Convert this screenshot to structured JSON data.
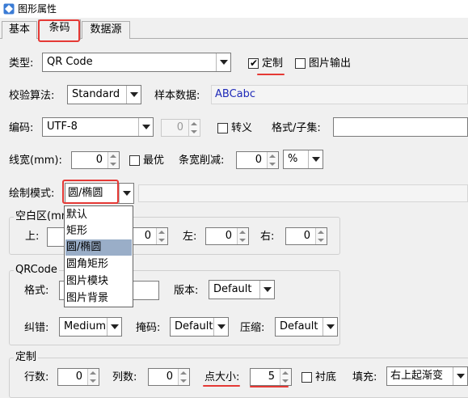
{
  "window": {
    "title": "图形属性"
  },
  "tabs": [
    {
      "label": "基本"
    },
    {
      "label": "条码"
    },
    {
      "label": "数据源"
    }
  ],
  "type_row": {
    "label": "类型:",
    "value": "QR Code",
    "custom_label": "定制",
    "custom_checked": true,
    "image_output_label": "图片输出",
    "image_output_checked": false
  },
  "check_row": {
    "label": "校验算法:",
    "value": "Standard",
    "sample_label": "样本数据:",
    "sample_value": "ABCabc"
  },
  "encoding_row": {
    "label": "编码:",
    "value": "UTF-8",
    "spin_value": "0",
    "escape_label": "转义",
    "format_label": "格式/子集:",
    "format_value": ""
  },
  "width_row": {
    "label": "线宽(mm):",
    "value": "0",
    "optimal_label": "最优",
    "reduce_label": "条宽削减:",
    "reduce_value": "0",
    "unit": "%"
  },
  "draw_row": {
    "label": "绘制模式:",
    "value": "圆/椭圆",
    "options": [
      "默认",
      "矩形",
      "圆/椭圆",
      "圆角矩形",
      "图片模块",
      "图片背景"
    ],
    "selected_index": 2
  },
  "quiet_zone": {
    "title": "空白区(mm)",
    "top_label": "上:",
    "left_label": "左:",
    "right_label": "右:",
    "bottom_value": "0",
    "left_value": "0",
    "right_value": "0"
  },
  "qrcode_group": {
    "title": "QRCode",
    "format_label": "格式:",
    "format_value": "",
    "version_label": "版本:",
    "version_value": "Default",
    "ec_label": "纠错:",
    "ec_value": "Medium",
    "mask_label": "掩码:",
    "mask_value": "Default",
    "compress_label": "压缩:",
    "compress_value": "Default"
  },
  "custom_group": {
    "title": "定制",
    "rows_label": "行数:",
    "rows_value": "0",
    "cols_label": "列数:",
    "cols_value": "0",
    "dot_label": "点大小:",
    "dot_value": "5",
    "bg_label": "衬底",
    "bg_checked": false,
    "fill_label": "填充:",
    "fill_value": "右上起渐变"
  },
  "colors": {
    "annotation": "#e53935",
    "sample_text": "#1f2ab8",
    "selection": "#9aaec8"
  }
}
